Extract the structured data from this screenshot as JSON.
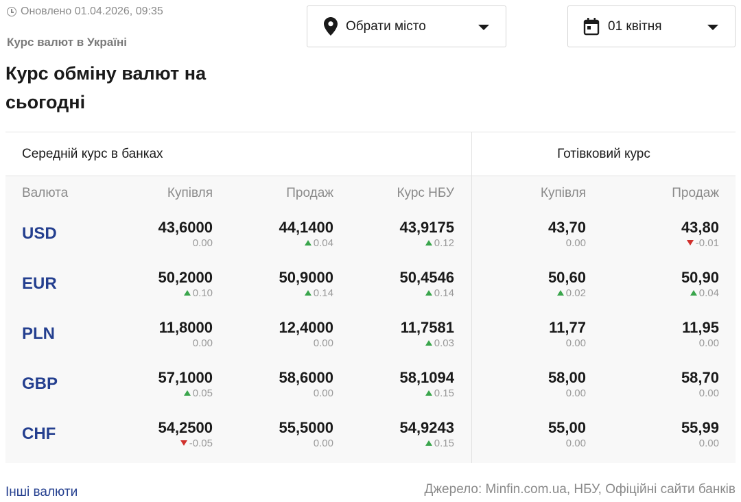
{
  "header": {
    "updated": "Оновлено 01.04.2026, 09:35",
    "subtitle": "Курс валют в Україні",
    "title": "Курс обміну валют на сьогодні"
  },
  "filters": {
    "city_label": "Обрати місто",
    "date_label": "01 квітня"
  },
  "table": {
    "group_average": "Середній курс в банках",
    "group_cash": "Готівковий курс",
    "columns": [
      "Валюта",
      "Купівля",
      "Продаж",
      "Курс НБУ",
      "Купівля",
      "Продаж"
    ],
    "rows": [
      {
        "code": "USD",
        "cells": [
          {
            "value": "43,6000",
            "change": "0.00",
            "dir": "none"
          },
          {
            "value": "44,1400",
            "change": "0.04",
            "dir": "up"
          },
          {
            "value": "43,9175",
            "change": "0.12",
            "dir": "up"
          },
          {
            "value": "43,70",
            "change": "0.00",
            "dir": "none"
          },
          {
            "value": "43,80",
            "change": "-0.01",
            "dir": "down"
          }
        ]
      },
      {
        "code": "EUR",
        "cells": [
          {
            "value": "50,2000",
            "change": "0.10",
            "dir": "up"
          },
          {
            "value": "50,9000",
            "change": "0.14",
            "dir": "up"
          },
          {
            "value": "50,4546",
            "change": "0.14",
            "dir": "up"
          },
          {
            "value": "50,60",
            "change": "0.02",
            "dir": "up"
          },
          {
            "value": "50,90",
            "change": "0.04",
            "dir": "up"
          }
        ]
      },
      {
        "code": "PLN",
        "cells": [
          {
            "value": "11,8000",
            "change": "0.00",
            "dir": "none"
          },
          {
            "value": "12,4000",
            "change": "0.00",
            "dir": "none"
          },
          {
            "value": "11,7581",
            "change": "0.03",
            "dir": "up"
          },
          {
            "value": "11,77",
            "change": "0.00",
            "dir": "none"
          },
          {
            "value": "11,95",
            "change": "0.00",
            "dir": "none"
          }
        ]
      },
      {
        "code": "GBP",
        "cells": [
          {
            "value": "57,1000",
            "change": "0.05",
            "dir": "up"
          },
          {
            "value": "58,6000",
            "change": "0.00",
            "dir": "none"
          },
          {
            "value": "58,1094",
            "change": "0.15",
            "dir": "up"
          },
          {
            "value": "58,00",
            "change": "0.00",
            "dir": "none"
          },
          {
            "value": "58,70",
            "change": "0.00",
            "dir": "none"
          }
        ]
      },
      {
        "code": "CHF",
        "cells": [
          {
            "value": "54,2500",
            "change": "-0.05",
            "dir": "down"
          },
          {
            "value": "55,5000",
            "change": "0.00",
            "dir": "none"
          },
          {
            "value": "54,9243",
            "change": "0.15",
            "dir": "up"
          },
          {
            "value": "55,00",
            "change": "0.00",
            "dir": "none"
          },
          {
            "value": "55,99",
            "change": "0.00",
            "dir": "none"
          }
        ]
      }
    ]
  },
  "footer": {
    "other_link": "Інші валюти",
    "source": "Джерело: Minfin.com.ua, НБУ, Офіційні сайти банків"
  },
  "colors": {
    "currency_code": "#243f8f",
    "up": "#3aa54c",
    "down": "#d0312d"
  },
  "icons": {
    "updated": "clock-icon",
    "city": "map-pin-icon",
    "date": "calendar-icon",
    "dropdown": "chevron-down-icon",
    "up": "triangle-up-icon",
    "down": "triangle-down-icon"
  }
}
